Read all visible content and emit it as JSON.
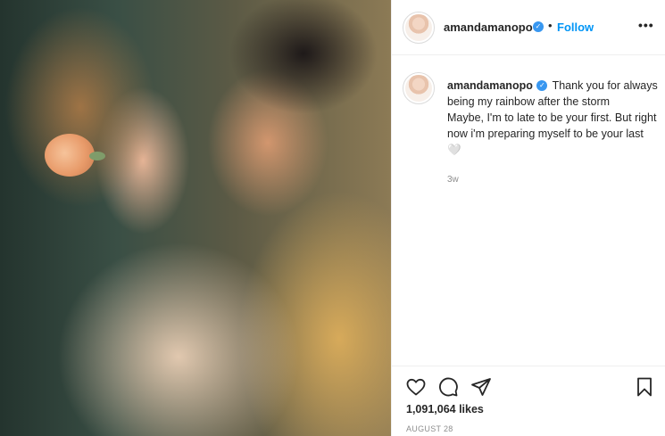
{
  "post": {
    "username": "amandamanopo",
    "follow_label": "Follow",
    "separator": "•",
    "more_label": "•••",
    "verified_mark": "✓"
  },
  "caption": {
    "username": "amandamanopo",
    "line1": "Thank you for always being my rainbow after the storm",
    "line2": "Maybe, I'm to late to be your first. But right now i'm preparing myself to be your last 🤍",
    "time": "3w"
  },
  "actions": {
    "icons": [
      "heart-icon",
      "comment-icon",
      "share-icon",
      "bookmark-icon"
    ]
  },
  "likes": "1,091,064 likes",
  "date": "AUGUST 28",
  "colors": {
    "accent": "#0095f6",
    "verified": "#3897f0",
    "muted": "#8e8e8e",
    "text": "#262626"
  }
}
